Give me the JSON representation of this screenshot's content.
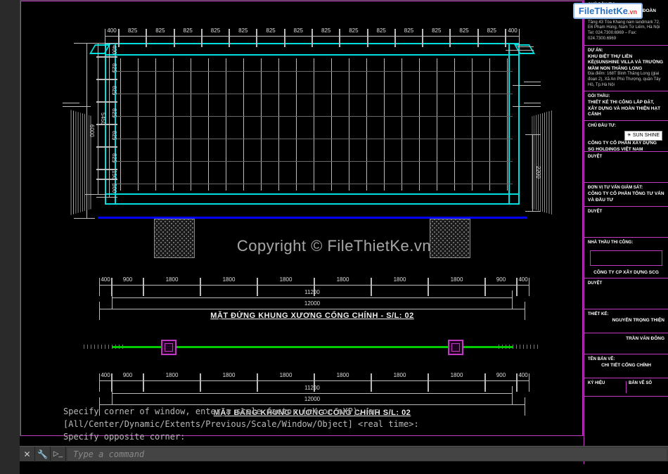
{
  "watermark": {
    "brand_prefix": "File",
    "brand_main": "ThietKe",
    "brand_suffix": ".vn"
  },
  "copyright": "Copyright © FileThietKe.vn",
  "elevation": {
    "title": "MẶT ĐỨNG KHUNG XƯƠNG CỔNG CHÍNH - S/L: 02",
    "top_dims": [
      "400",
      "825",
      "825",
      "825",
      "825",
      "825",
      "825",
      "825",
      "825",
      "825",
      "825",
      "825",
      "825",
      "825",
      "825",
      "400"
    ],
    "left_total_outer": "6000",
    "left_total_inner": "5450",
    "left_dims": [
      "400",
      "825",
      "825",
      "825",
      "825",
      "825",
      "150",
      "500"
    ],
    "right_one": "2200",
    "bottom_dims": [
      "400",
      "900",
      "1800",
      "1800",
      "1800",
      "1800",
      "1800",
      "1800",
      "900",
      "400"
    ],
    "bottom_mid": "11200",
    "bottom_total": "12000"
  },
  "plan": {
    "title": "MẶT BẰNG KHUNG XƯƠNG CỔNG CHÍNH   S/L: 02",
    "bottom_dims": [
      "400",
      "900",
      "1800",
      "1800",
      "1800",
      "1800",
      "1800",
      "1800",
      "900",
      "400"
    ],
    "bottom_mid": "11200",
    "bottom_total": "12000"
  },
  "cmd": {
    "line1": "Specify corner of window, enter a scale factor (nX or nXP), or",
    "line2": "[All/Center/Dynamic/Extents/Previous/Scale/Window/Object] <real time>:",
    "line3": "Specify opposite corner:",
    "placeholder": "Type a command"
  },
  "titleblock": {
    "owner_head": "CHỦ ĐẦU TƯ:",
    "owner": "CÔNG TY CỔ PHẦN TẬP ĐOÀN SUNSHINE",
    "owner_addr": "Tầng 43 Tòa Khang nam landmark 72, E6 Phạm Hùng, Nam Từ Liêm, Hà Nội",
    "owner_tel": "Tel: 024.7300.6969 – Fax: 024.7300.6969",
    "project_head": "DỰ ÁN:",
    "project": "KHU BIỆT THỰ LIỀN KỀ(SUNSHINE VILLA VÀ TRƯỜNG MẦM NON THĂNG LONG",
    "project_loc": "Địa điểm: 168T Bình Thăng Long (giai đoạn 2), Xã An Phú Thượng, quận Tây Hồ, Tp.Hà Nội",
    "sector_head": "GÓI THẦU:",
    "sector": "THIẾT KẾ THI CÔNG LẮP ĐẶT, XÂY DỰNG VÀ HOÀN THIỆN HẠT CẢNH",
    "unit1_head": "CHỦ ĐẦU TƯ:",
    "unit1": "CÔNG TY CỔ PHẦN XÂY DỰNG SG HOLDINGS VIỆT NAM",
    "approve": "DUYỆT",
    "consult_head": "ĐƠN VỊ TƯ VẤN GIÁM SÁT:",
    "consult": "CÔNG TY CỔ PHẦN TỔNG TƯ VẤN VÀ ĐẦU TƯ",
    "contractor_head": "NHÀ THẦU THI CÔNG:",
    "contractor": "CÔNG TY CP XÂY DỰNG SCG",
    "designer_head": "THIẾT KẾ:",
    "designer": "NGUYỄN TRỌNG THIỆN",
    "checker": "TRẦN VĂN ĐÔNG",
    "drawing_head": "TÊN BẢN VẼ:",
    "drawing": "CHI TIẾT CỔNG CHÍNH",
    "sheet_head": "KÝ HIỆU",
    "sheet_no_head": "BẢN VẼ SỐ"
  }
}
